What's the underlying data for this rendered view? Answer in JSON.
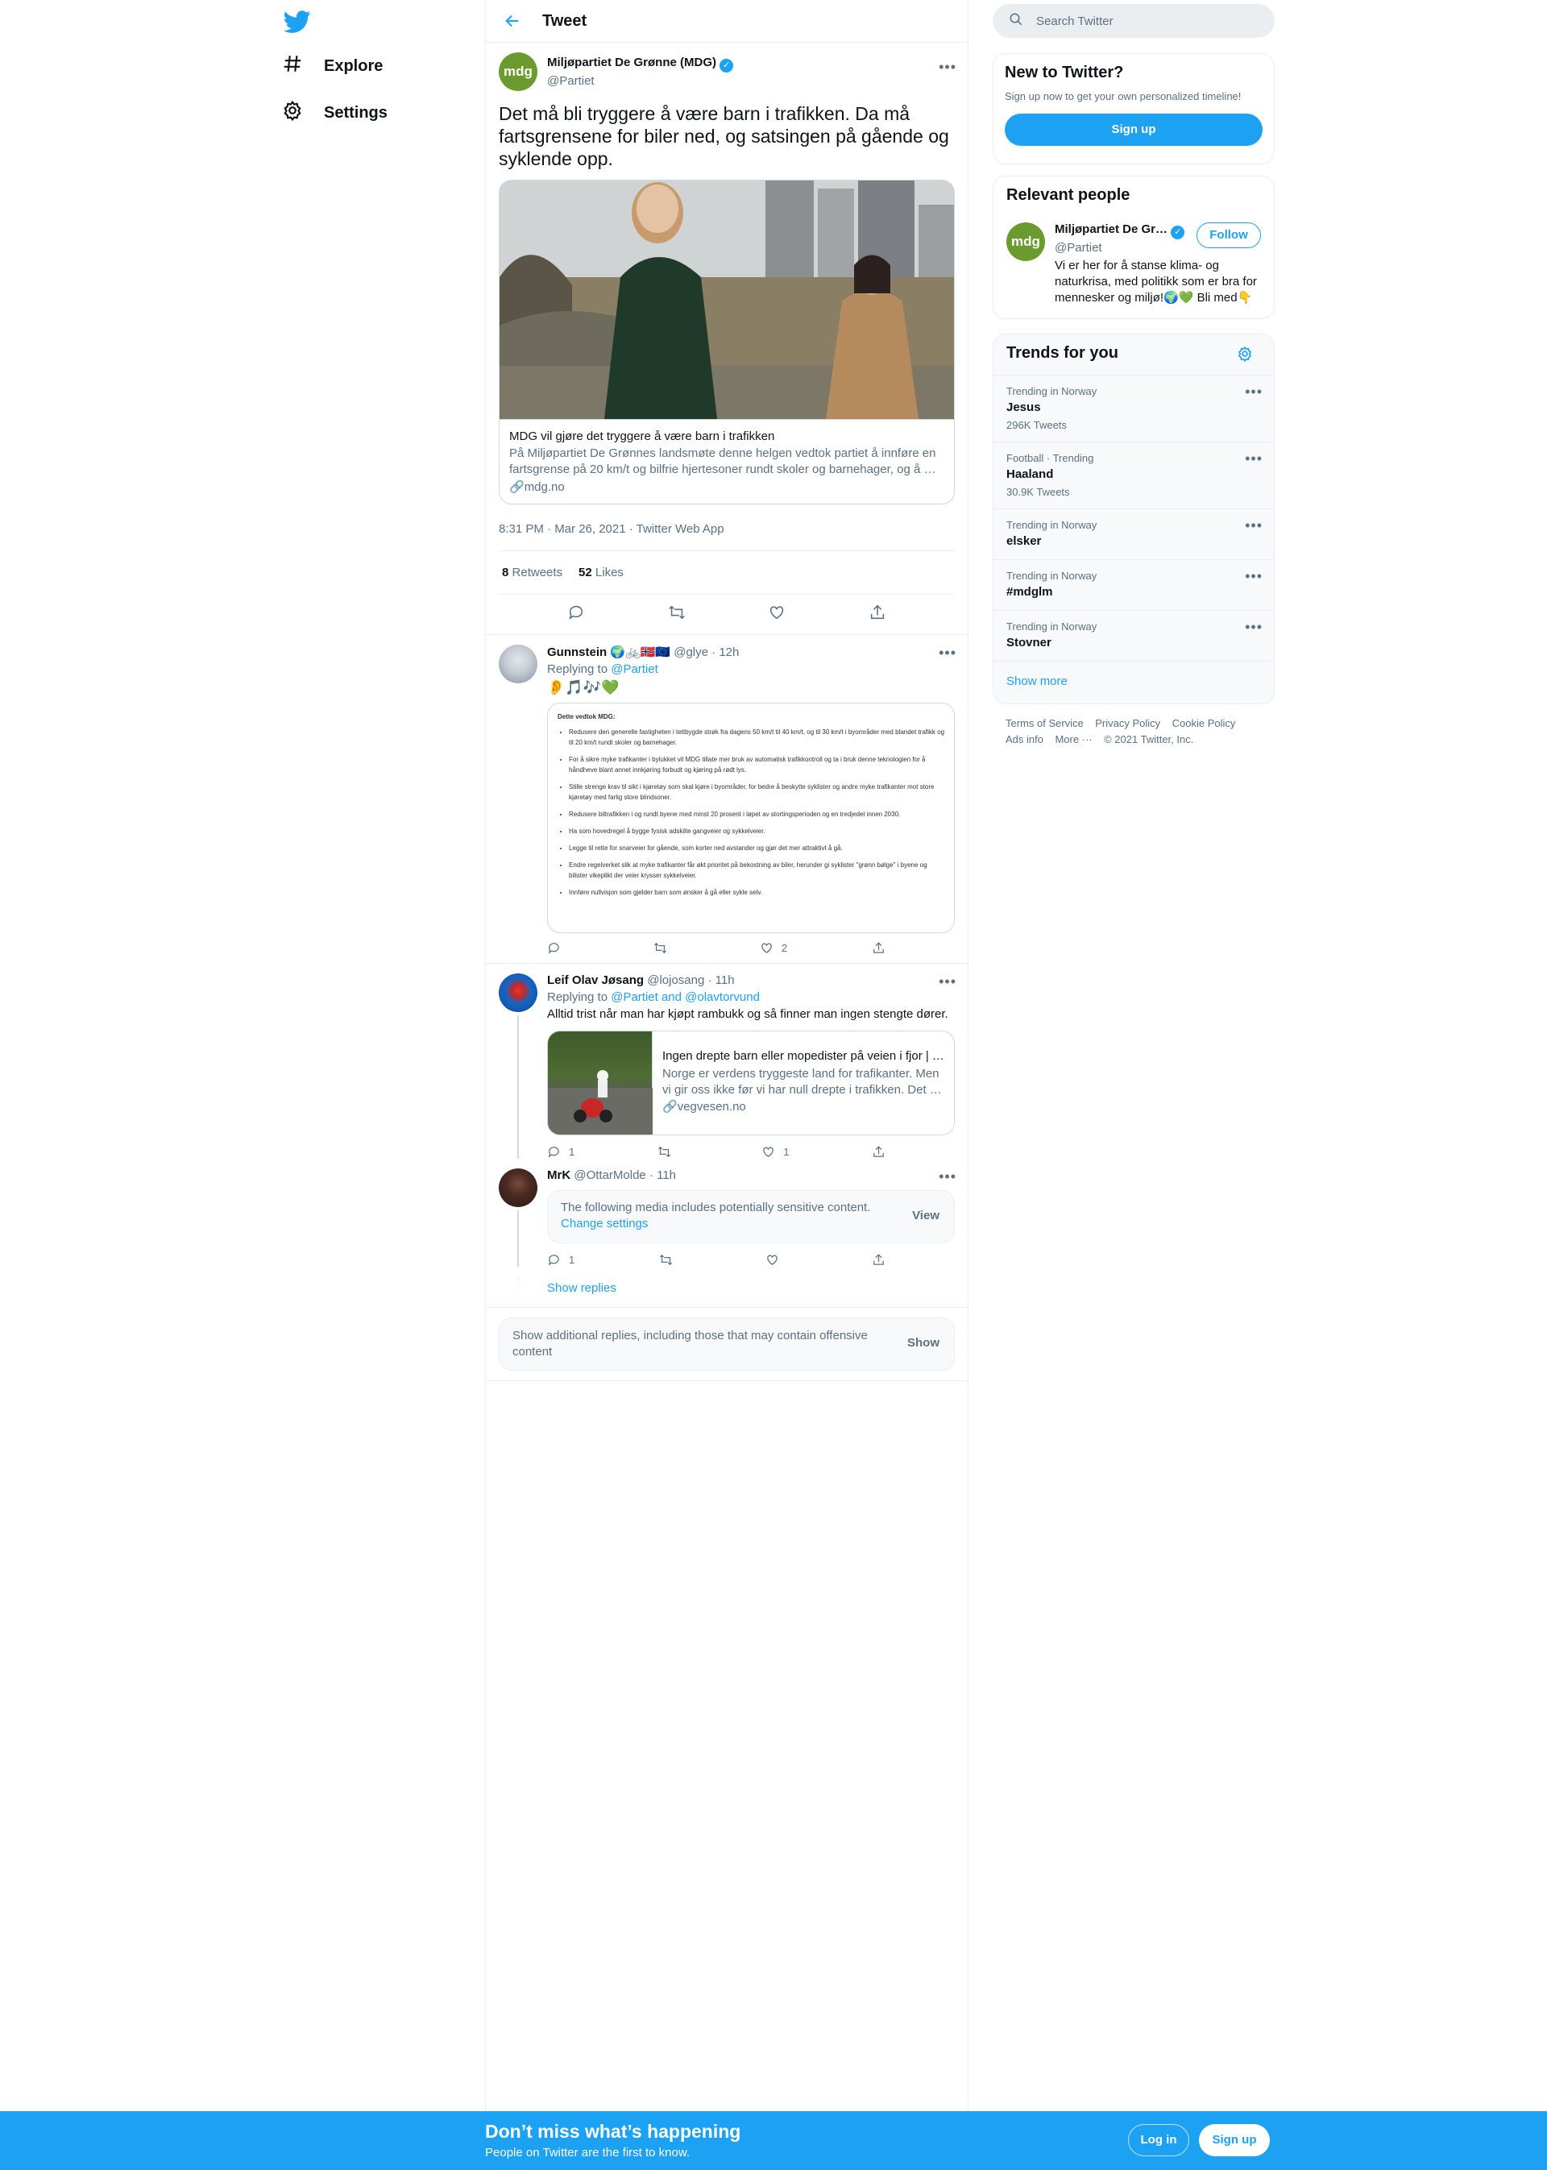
{
  "nav": {
    "logo": "twitter-logo",
    "items": [
      {
        "label": "Explore",
        "icon": "hashtag-icon"
      },
      {
        "label": "Settings",
        "icon": "gear-icon"
      }
    ]
  },
  "header": {
    "title": "Tweet"
  },
  "tweet": {
    "avatar_text": "mdg",
    "name": "Miljøpartiet De Grønne (MDG)",
    "handle": "@Partiet",
    "text": "Det må bli tryggere å være barn i trafikken. Da må fartsgrensene for biler ned, og satsingen på gående og syklende opp.",
    "card": {
      "title": "MDG vil gjøre det tryggere å være barn i trafikken",
      "description": "På Miljøpartiet De Grønnes landsmøte denne helgen vedtok partiet å innføre en fartsgrense på 20 km/t og bilfrie hjertesoner rundt skoler og barnehager, og å …",
      "domain": "mdg.no"
    },
    "meta": "8:31 PM · Mar 26, 2021 · Twitter Web App",
    "retweets": "8",
    "retweets_label": "Retweets",
    "likes": "52",
    "likes_label": "Likes"
  },
  "replies": [
    {
      "name": "Gunnstein",
      "name_emoji": "🌍🚲🇳🇴🇪🇺",
      "handle": "@glye",
      "time": "12h",
      "replying_prefix": "Replying to",
      "replying_to": "@Partiet",
      "text": "👂🎵🎶💚",
      "doc": {
        "heading": "Dette vedtok MDG:",
        "bullets": [
          "Redusere den generelle fastigheten i tettbygde strøk fra dagens 50 km/t til 40 km/t, og til 30 km/t i byområder med blandet trafikk og til 20 km/t rundt skoler og barnehager.",
          "For å sikre myke trafikanter i bylukket vil MDG tillate mer bruk av automatisk trafikkontroll og ta i bruk denne teknologien for å håndheve blant annet innkjøring forbudt og kjøring på rødt lys.",
          "Stille strenge krav til sikt i kjøretøy som skal kjøre i byområder, for bedre å beskytte syklister og andre myke trafikanter mot store kjøretøy med farlig store blindsoner.",
          "Redusere biltrafikken i og rundt byene med minst 20 prosent i løpet av stortingsperioden og en tredjedel innen 2030.",
          "Ha som hovedregel å bygge fysisk adskilte gangveier og sykkelveier.",
          "Legge til rette for snarveier for gående, som korter ned avstander og gjør det mer attraktivt å gå.",
          "Endre regelverket slik at myke trafikanter får økt prioritet på bekostning av biler, herunder gi syklister \"grønn bølge\" i byene og bilister vikeplikt der veier krysser sykkelveier.",
          "Innføre nullvisjon som gjelder barn som ønsker å gå eller sykle selv."
        ]
      },
      "reply_count": "",
      "retweet_count": "",
      "like_count": "2"
    },
    {
      "name": "Leif Olav Jøsang",
      "handle": "@lojosang",
      "time": "11h",
      "replying_prefix": "Replying to",
      "replying_to": "@Partiet and @olavtorvund",
      "text": "Alltid trist når man har kjøpt rambukk og så finner man ingen stengte dører.",
      "card": {
        "title": "Ingen drepte barn eller mopedister på veien i fjor | …",
        "description": "Norge er verdens tryggeste land for trafikanter. Men vi gir oss ikke før vi har null drepte i trafikken. Det …",
        "domain": "vegvesen.no"
      },
      "reply_count": "1",
      "retweet_count": "",
      "like_count": "1"
    },
    {
      "name": "MrK",
      "handle": "@OttarMolde",
      "time": "11h",
      "sensitive": {
        "text": "The following media includes potentially sensitive content.",
        "link": "Change settings",
        "view": "View"
      },
      "reply_count": "1",
      "retweet_count": "",
      "like_count": ""
    }
  ],
  "show_replies": "Show replies",
  "additional": {
    "text": "Show additional replies, including those that may contain offensive content",
    "button": "Show"
  },
  "sidebar": {
    "search_placeholder": "Search Twitter",
    "new_to_twitter": {
      "title": "New to Twitter?",
      "text": "Sign up now to get your own personalized timeline!",
      "button": "Sign up"
    },
    "relevant": {
      "title": "Relevant people",
      "avatar_text": "mdg",
      "name": "Miljøpartiet De Gr…",
      "handle": "@Partiet",
      "follow": "Follow",
      "bio": "Vi er her for å stanse klima- og naturkrisa, med politikk som er bra for mennesker og miljø!🌍💚 Bli med👇"
    },
    "trends": {
      "title": "Trends for you",
      "items": [
        {
          "category": "Trending in Norway",
          "name": "Jesus",
          "count": "296K Tweets"
        },
        {
          "category": "Football · Trending",
          "name": "Haaland",
          "count": "30.9K Tweets"
        },
        {
          "category": "Trending in Norway",
          "name": "elsker",
          "count": ""
        },
        {
          "category": "Trending in Norway",
          "name": "#mdglm",
          "count": ""
        },
        {
          "category": "Trending in Norway",
          "name": "Stovner",
          "count": ""
        }
      ],
      "show_more": "Show more"
    },
    "footer": {
      "links": [
        "Terms of Service",
        "Privacy Policy",
        "Cookie Policy",
        "Ads info",
        "More ···"
      ],
      "copyright": "© 2021 Twitter, Inc."
    }
  },
  "bottom_bar": {
    "title": "Don’t miss what’s happening",
    "subtitle": "People on Twitter are the first to know.",
    "login": "Log in",
    "signup": "Sign up"
  },
  "colors": {
    "accent": "#1da1f2",
    "mdg_green": "#6b9a2e",
    "like_green": "#43a047"
  }
}
